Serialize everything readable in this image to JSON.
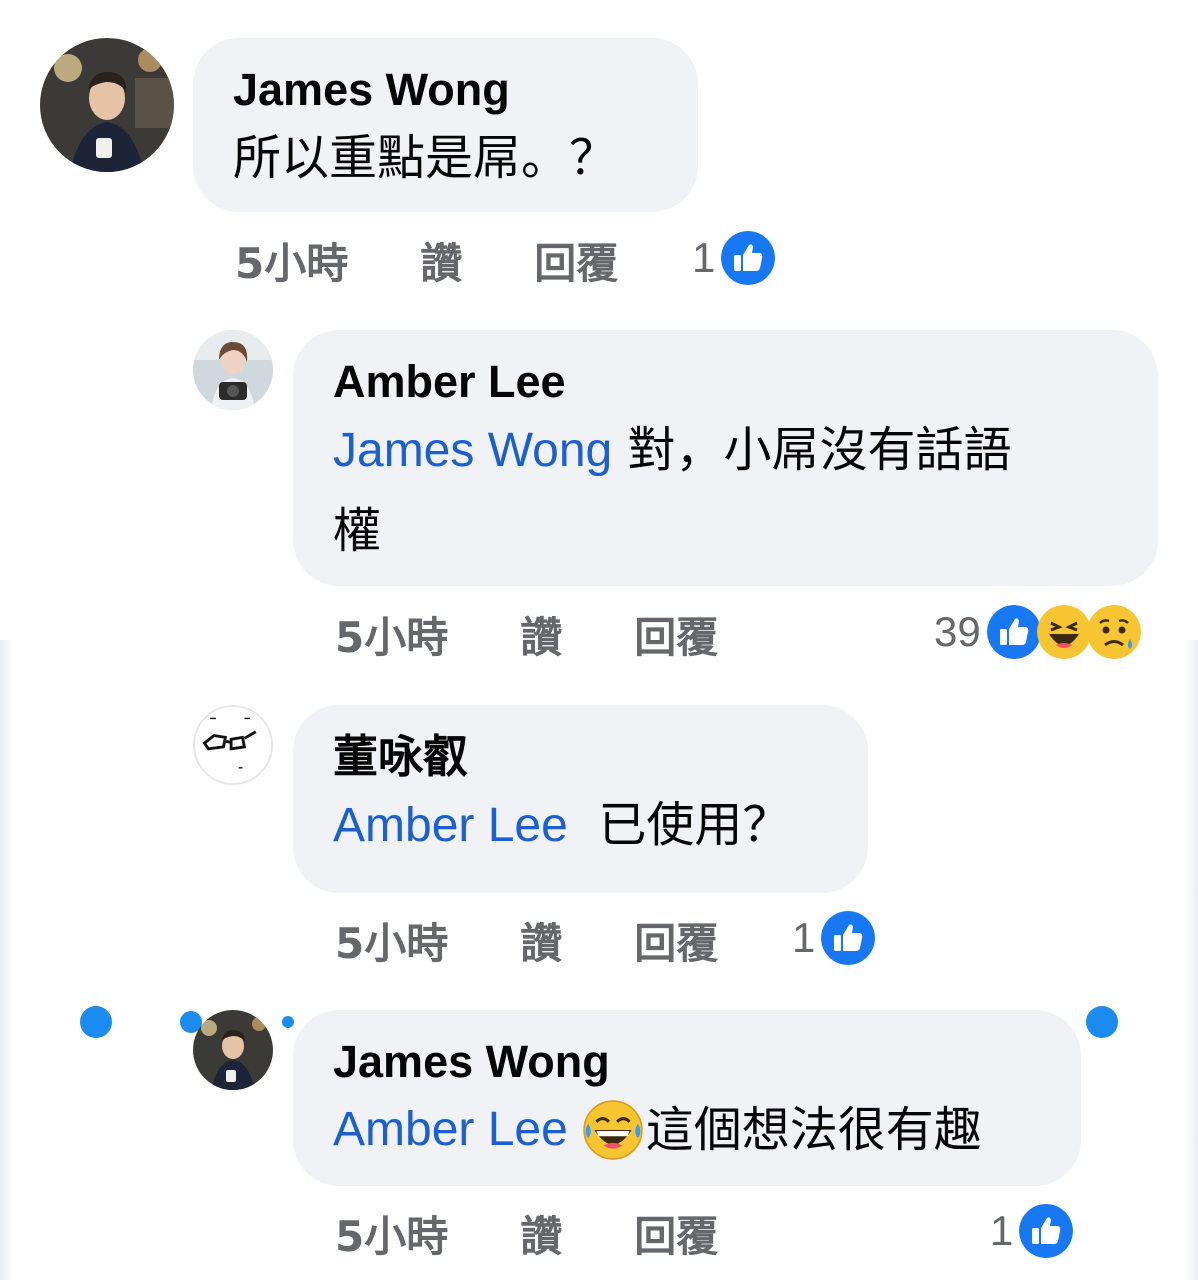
{
  "comments": [
    {
      "author": "James Wong",
      "mention": "",
      "text": "所以重點是屌。？",
      "time": "5小時",
      "like": "讚",
      "reply": "回覆",
      "reaction_count": "1",
      "reactions": [
        "like-icon"
      ]
    },
    {
      "author": "Amber Lee",
      "mention": "James Wong",
      "text_line1": "對，小屌沒有話語",
      "text_line2": "權",
      "time": "5小時",
      "like": "讚",
      "reply": "回覆",
      "reaction_count": "39",
      "reactions": [
        "like-icon",
        "haha-icon",
        "sad-icon"
      ]
    },
    {
      "author": "董咏叡",
      "mention": "Amber Lee",
      "text": "已使用？",
      "time": "5小時",
      "like": "讚",
      "reply": "回覆",
      "reaction_count": "1",
      "reactions": [
        "like-icon"
      ]
    },
    {
      "author": "James Wong",
      "mention": "Amber Lee",
      "emoji": "laughing-tears-emoji",
      "text": "這個想法很有趣",
      "time": "5小時",
      "like": "讚",
      "reply": "回覆",
      "reaction_count": "1",
      "reactions": [
        "like-icon"
      ]
    }
  ],
  "colors": {
    "bubble": "#f0f2f5",
    "mention": "#1b5fd0",
    "meta": "#65676b",
    "like_blue": "#1877f2",
    "selection_dot": "#1a8cf0"
  }
}
